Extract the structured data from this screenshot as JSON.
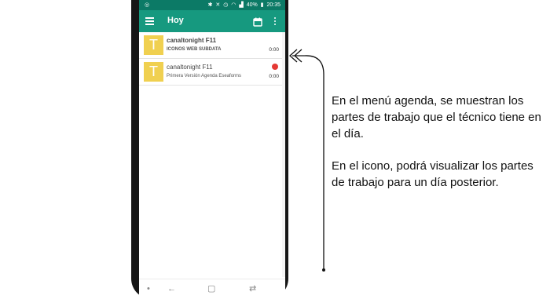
{
  "status_bar": {
    "left_icon": "app-notification-icon",
    "icons": [
      "bluetooth-icon",
      "mute-icon",
      "alarm-icon",
      "wifi-icon",
      "signal-icon"
    ],
    "battery": "40%",
    "time": "20:35"
  },
  "app_bar": {
    "title": "Hoy",
    "menu_icon": "hamburger-menu-icon",
    "calendar_icon": "calendar-icon",
    "more_icon": "more-vertical-icon",
    "color": "#16997f",
    "status_color": "#0c7a66"
  },
  "tasks": [
    {
      "avatar_letter": "T",
      "name": "canaltonight F11",
      "description": "ICONOS WEB SUBDATA",
      "time": "0:00",
      "recording": false
    },
    {
      "avatar_letter": "T",
      "name": "canaltonight F11",
      "description": "Primera Versión Agenda Eseaforms",
      "time": "0:00",
      "recording": true
    }
  ],
  "nav_bar": {
    "icons": [
      "dot-icon",
      "back-arrow-icon",
      "home-square-icon",
      "recent-apps-icon"
    ],
    "glyphs": [
      "•",
      "←",
      "▢",
      "⇄"
    ]
  },
  "annotation": {
    "paragraph1": "En el menú agenda, se muestran los partes de trabajo que el técnico tiene en el día.",
    "paragraph2": "En el icono, podrá visualizar los partes de trabajo para un día posterior."
  },
  "colors": {
    "avatar": "#f0d050",
    "record_dot": "#e53935"
  }
}
